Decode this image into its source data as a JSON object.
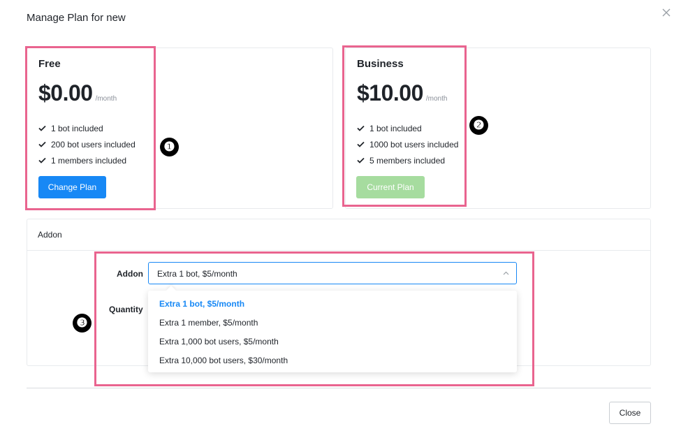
{
  "modal": {
    "title": "Manage Plan for new",
    "close_icon": "close-icon"
  },
  "plans": [
    {
      "name": "Free",
      "price": "$0.00",
      "period": "/month",
      "features": [
        "1 bot included",
        "200 bot users included",
        "1 members included"
      ],
      "button": "Change Plan"
    },
    {
      "name": "Business",
      "price": "$10.00",
      "period": "/month",
      "features": [
        "1 bot included",
        "1000 bot users included",
        "5 members included"
      ],
      "button": "Current Plan"
    }
  ],
  "addon": {
    "section_title": "Addon",
    "addon_label": "Addon",
    "quantity_label": "Quantity",
    "selected": "Extra 1 bot, $5/month",
    "options": [
      "Extra 1 bot, $5/month",
      "Extra 1 member, $5/month",
      "Extra 1,000 bot users, $5/month",
      "Extra 10,000 bot users, $30/month"
    ]
  },
  "annotations": {
    "badge1": "❶",
    "badge2": "❷",
    "badge3": "❸",
    "highlight_color": "#e9648f"
  },
  "footer": {
    "close_label": "Close"
  },
  "colors": {
    "primary": "#1788f5",
    "current_plan": "#a6dc9f"
  }
}
